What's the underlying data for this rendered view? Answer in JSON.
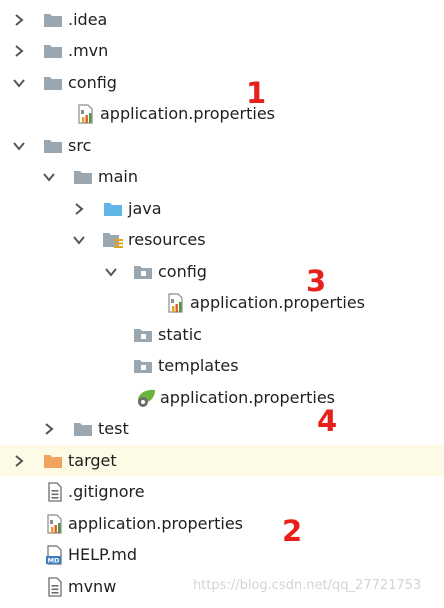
{
  "tree": {
    "items": [
      {
        "label": ".idea",
        "icon": "folder-icon",
        "expanded": false
      },
      {
        "label": ".mvn",
        "icon": "folder-icon",
        "expanded": false
      },
      {
        "label": "config",
        "icon": "folder-icon",
        "expanded": true
      },
      {
        "label": "application.properties",
        "icon": "properties-file-icon"
      },
      {
        "label": "src",
        "icon": "folder-icon",
        "expanded": true
      },
      {
        "label": "main",
        "icon": "folder-icon",
        "expanded": true
      },
      {
        "label": "java",
        "icon": "source-folder-icon",
        "expanded": false
      },
      {
        "label": "resources",
        "icon": "resources-folder-icon",
        "expanded": true
      },
      {
        "label": "config",
        "icon": "folder-icon",
        "expanded": true
      },
      {
        "label": "application.properties",
        "icon": "properties-file-icon"
      },
      {
        "label": "static",
        "icon": "folder-icon"
      },
      {
        "label": "templates",
        "icon": "folder-icon"
      },
      {
        "label": "application.properties",
        "icon": "spring-properties-icon"
      },
      {
        "label": "test",
        "icon": "folder-icon",
        "expanded": false
      },
      {
        "label": "target",
        "icon": "excluded-folder-icon",
        "expanded": false
      },
      {
        "label": ".gitignore",
        "icon": "text-file-icon"
      },
      {
        "label": "application.properties",
        "icon": "properties-file-icon"
      },
      {
        "label": "HELP.md",
        "icon": "markdown-file-icon"
      },
      {
        "label": "mvnw",
        "icon": "text-file-icon"
      }
    ]
  },
  "annotations": [
    "1",
    "3",
    "4",
    "2"
  ],
  "md_badge": "MD",
  "watermark": "https://blog.csdn.net/qq_27721753",
  "colors": {
    "folder": "#9aa7b0",
    "source_folder": "#5fb6e6",
    "excluded_folder": "#f0a35e",
    "annotation": "#e8201c",
    "highlight_row": "#fdfbe6"
  }
}
